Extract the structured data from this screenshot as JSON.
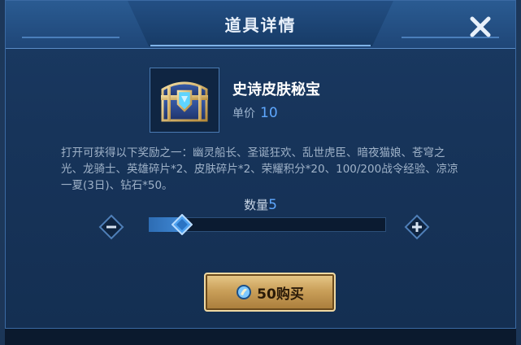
{
  "dialog": {
    "title": "道具详情"
  },
  "item": {
    "name": "史诗皮肤秘宝",
    "price_label": "单价",
    "price_value": "10",
    "description": "打开可获得以下奖励之一：幽灵船长、圣诞狂欢、乱世虎臣、暗夜猫娘、苍穹之光、龙骑士、英雄碎片*2、皮肤碎片*2、荣耀积分*20、100/200战令经验、凉凉一夏(3日)、钻石*50。"
  },
  "quantity": {
    "label": "数量",
    "value": "5",
    "min": 1,
    "max": 100,
    "fraction": 0.05
  },
  "purchase": {
    "label": "50购买",
    "currency_icon": "coupon-icon"
  },
  "icons": {
    "close": "close-icon",
    "minus": "minus-icon",
    "plus": "plus-icon",
    "chest": "treasure-chest-icon"
  },
  "colors": {
    "accent_blue": "#5fa8ff",
    "panel": "#17345a",
    "gold": "#caa05a"
  }
}
